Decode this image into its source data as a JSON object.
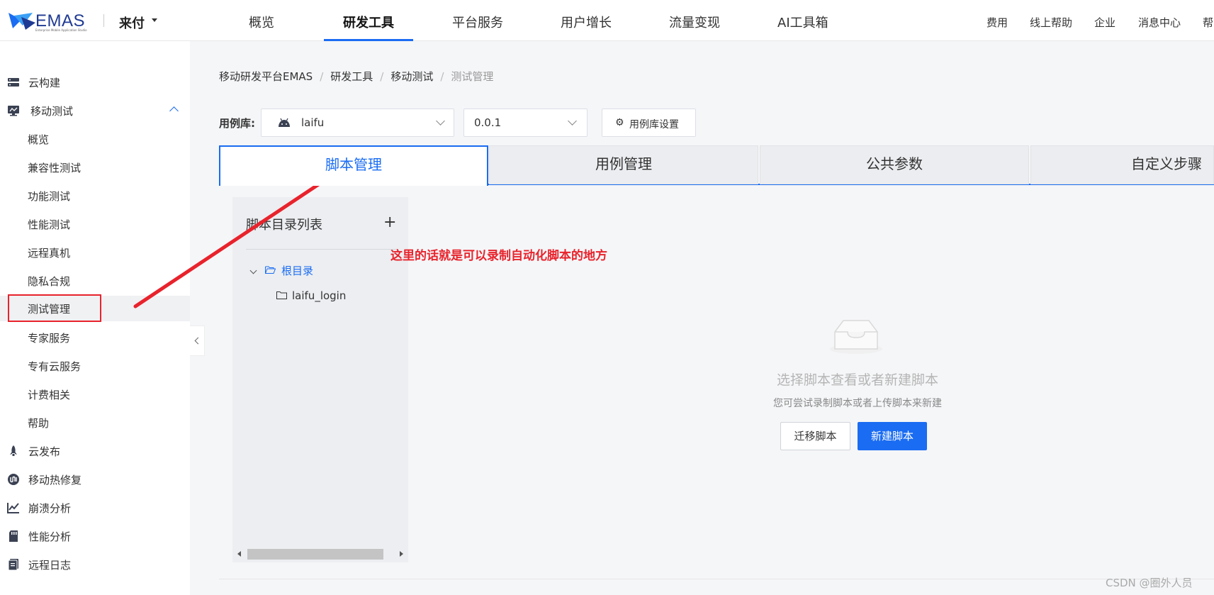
{
  "header": {
    "brand": "EMAS",
    "brand_sub": "Enterprise Mobile Application Studio",
    "workspace": "来付",
    "tabs": [
      "概览",
      "研发工具",
      "平台服务",
      "用户增长",
      "流量变现",
      "AI工具箱"
    ],
    "active_tab": "研发工具",
    "right_links": [
      "费用",
      "线上帮助",
      "企业",
      "消息中心",
      "帮"
    ]
  },
  "sidebar": {
    "items": [
      {
        "label": "云构建",
        "icon": "server-icon"
      },
      {
        "label": "移动测试",
        "icon": "monitor-icon",
        "expanded": true
      },
      {
        "label": "概览"
      },
      {
        "label": "兼容性测试"
      },
      {
        "label": "功能测试"
      },
      {
        "label": "性能测试"
      },
      {
        "label": "远程真机"
      },
      {
        "label": "隐私合规"
      },
      {
        "label": "测试管理",
        "active": true
      },
      {
        "label": "专家服务"
      },
      {
        "label": "专有云服务"
      },
      {
        "label": "计费相关"
      },
      {
        "label": "帮助"
      },
      {
        "label": "云发布",
        "icon": "rocket-icon"
      },
      {
        "label": "移动热修复",
        "icon": "hotfix-icon"
      },
      {
        "label": "崩溃分析",
        "icon": "chart-icon"
      },
      {
        "label": "性能分析",
        "icon": "sd-card-icon"
      },
      {
        "label": "远程日志",
        "icon": "log-icon"
      }
    ]
  },
  "breadcrumb": [
    "移动研发平台EMAS",
    "研发工具",
    "移动测试",
    "测试管理"
  ],
  "toolbar": {
    "library_label": "用例库:",
    "library_value": "laifu",
    "version_value": "0.0.1",
    "settings_label": "用例库设置"
  },
  "tabs": [
    "脚本管理",
    "用例管理",
    "公共参数",
    "自定义步骤"
  ],
  "active_tab": "脚本管理",
  "tree": {
    "title": "脚本目录列表",
    "add_symbol": "+",
    "root": "根目录",
    "children": [
      "laifu_login"
    ]
  },
  "annotation": "这里的话就是可以录制自动化脚本的地方",
  "empty_state": {
    "title": "选择脚本查看或者新建脚本",
    "subtitle": "您可尝试录制脚本或者上传脚本来新建",
    "secondary_button": "迁移脚本",
    "primary_button": "新建脚本"
  },
  "watermark": "CSDN @圈外人员",
  "colors": {
    "primary": "#1a6cf2",
    "annotation_red": "#e8232c",
    "folder_blue": "#1a6cf2"
  }
}
